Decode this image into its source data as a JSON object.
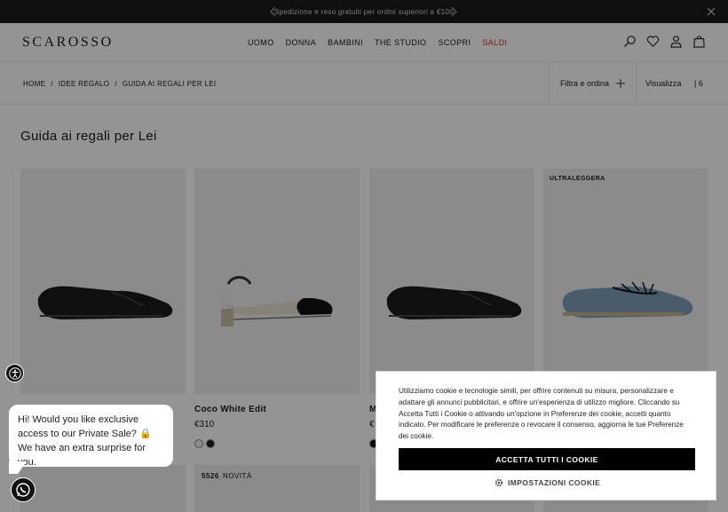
{
  "announcement": {
    "text": "Spedizione e reso gratuiti per ordini superiori a €100"
  },
  "header": {
    "logo": "SCAROSSO",
    "nav": [
      "UOMO",
      "DONNA",
      "BAMBINI",
      "THE STUDIO",
      "SCOPRI"
    ],
    "sale": "SALDI",
    "sale_color": "#c0392b"
  },
  "breadcrumb": {
    "home": "HOME",
    "sep": "/",
    "level2": "IDEE REGALO",
    "current": "GUIDA AI REGALI PER LEI"
  },
  "toolbar": {
    "filter_label": "Filtra e ordina",
    "view_label": "Visualizza",
    "view_count": "| 6"
  },
  "page": {
    "title": "Guida ai regali per Lei"
  },
  "products": [
    {
      "badge": "",
      "name": "",
      "price": ""
    },
    {
      "badge": "",
      "name": "Coco White Edit",
      "price": "€310"
    },
    {
      "badge": "",
      "name": "M",
      "price": "€"
    },
    {
      "badge": "ULTRALEGGERA",
      "name": "",
      "price": ""
    }
  ],
  "row2": {
    "code": "5526",
    "tag": "NOVITÀ"
  },
  "chat": {
    "message": "Hi! Would you like exclusive access to our Private Sale? 🔒 We have an extra surprise for you."
  },
  "cookie": {
    "text": "Utilizziamo cookie e tecnologie simili, per offrire contenuti su misura, personalizzare e adattare gli annunci pubblicitari, e offrire un'esperienza di utilizzo migliore. Cliccando su Accetta Tutti i Cookie o attivando un'opzione in Preferenze dei cookie, accetti quanto indicato. Per modificare le preferenze o revocare il consenso, aggiorna le tue Preferenze dei cookie.",
    "accept_label": "ACCETTA TUTTI I COOKIE",
    "settings_label": "IMPOSTAZIONI COOKIE"
  }
}
